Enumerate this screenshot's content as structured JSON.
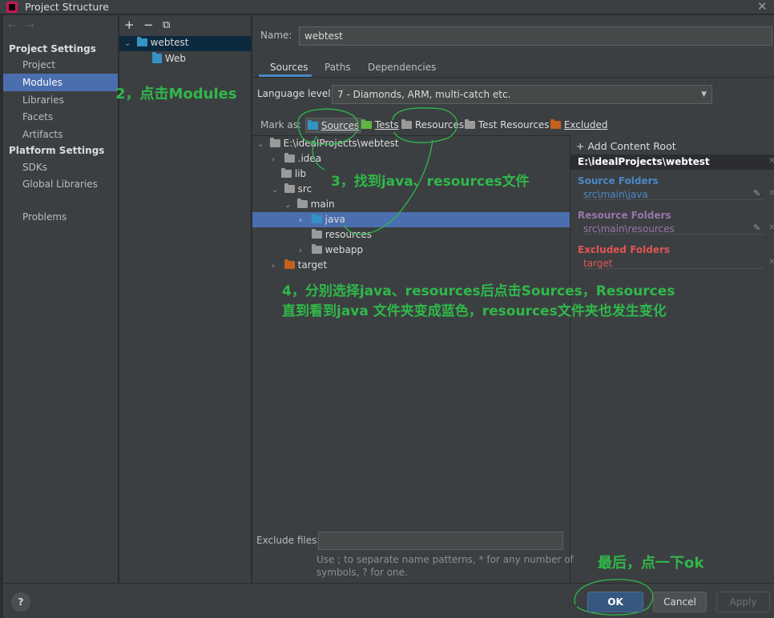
{
  "window": {
    "title": "Project Structure",
    "close_glyph": "✕"
  },
  "nav": {
    "back_glyph": "←",
    "forward_glyph": "→",
    "project_settings_header": "Project Settings",
    "items_project": [
      "Project",
      "Modules",
      "Libraries",
      "Facets",
      "Artifacts"
    ],
    "platform_settings_header": "Platform Settings",
    "items_platform": [
      "SDKs",
      "Global Libraries"
    ],
    "problems": "Problems"
  },
  "modules": {
    "toolbar": {
      "add": "+",
      "remove": "−",
      "copy": "⧉"
    },
    "items": [
      {
        "name": "webtest"
      },
      {
        "name": "Web"
      }
    ]
  },
  "main": {
    "name_label": "Name:",
    "name_value": "webtest",
    "tabs": [
      "Sources",
      "Paths",
      "Dependencies"
    ],
    "language_level_label": "Language level:",
    "language_level_value": "7 - Diamonds, ARM, multi-catch etc.",
    "mark_as_label": "Mark as:",
    "mark_buttons": [
      "Sources",
      "Tests",
      "Resources",
      "Test Resources",
      "Excluded"
    ],
    "tree": [
      {
        "label": "E:\\idealProjects\\webtest"
      },
      {
        "label": ".idea"
      },
      {
        "label": "lib"
      },
      {
        "label": "src"
      },
      {
        "label": "main"
      },
      {
        "label": "java"
      },
      {
        "label": "resources"
      },
      {
        "label": "webapp"
      },
      {
        "label": "target"
      }
    ],
    "exclude_files_label": "Exclude files:",
    "exclude_hint_1": "Use ; to separate name patterns, * for any number of",
    "exclude_hint_2": "symbols, ? for one."
  },
  "content_root": {
    "add_label": "+ Add Content Root",
    "root_path": "E:\\idealProjects\\webtest",
    "source_header": "Source Folders",
    "source_path": "src\\main\\java",
    "resource_header": "Resource Folders",
    "resource_path": "src\\main\\resources",
    "excluded_header": "Excluded Folders",
    "excluded_path": "target"
  },
  "annotations": {
    "step2": "2，点击Modules",
    "step3": "3，找到java、resources文件",
    "step4_line1": "4，分别选择java、resources后点击Sources，Resources",
    "step4_line2": "直到看到java 文件夹变成蓝色，resources文件夹也发生变化",
    "final": "最后，点一下ok"
  },
  "buttons": {
    "help": "?",
    "ok": "OK",
    "cancel": "Cancel",
    "apply": "Apply"
  },
  "colors": {
    "accent_blue": "#4a88c7",
    "selection": "#4b6eaf",
    "source_color": "#4a88c7",
    "resource_color": "#9876aa",
    "excluded_color": "#e05555",
    "annotation_green": "#2fb84a"
  }
}
